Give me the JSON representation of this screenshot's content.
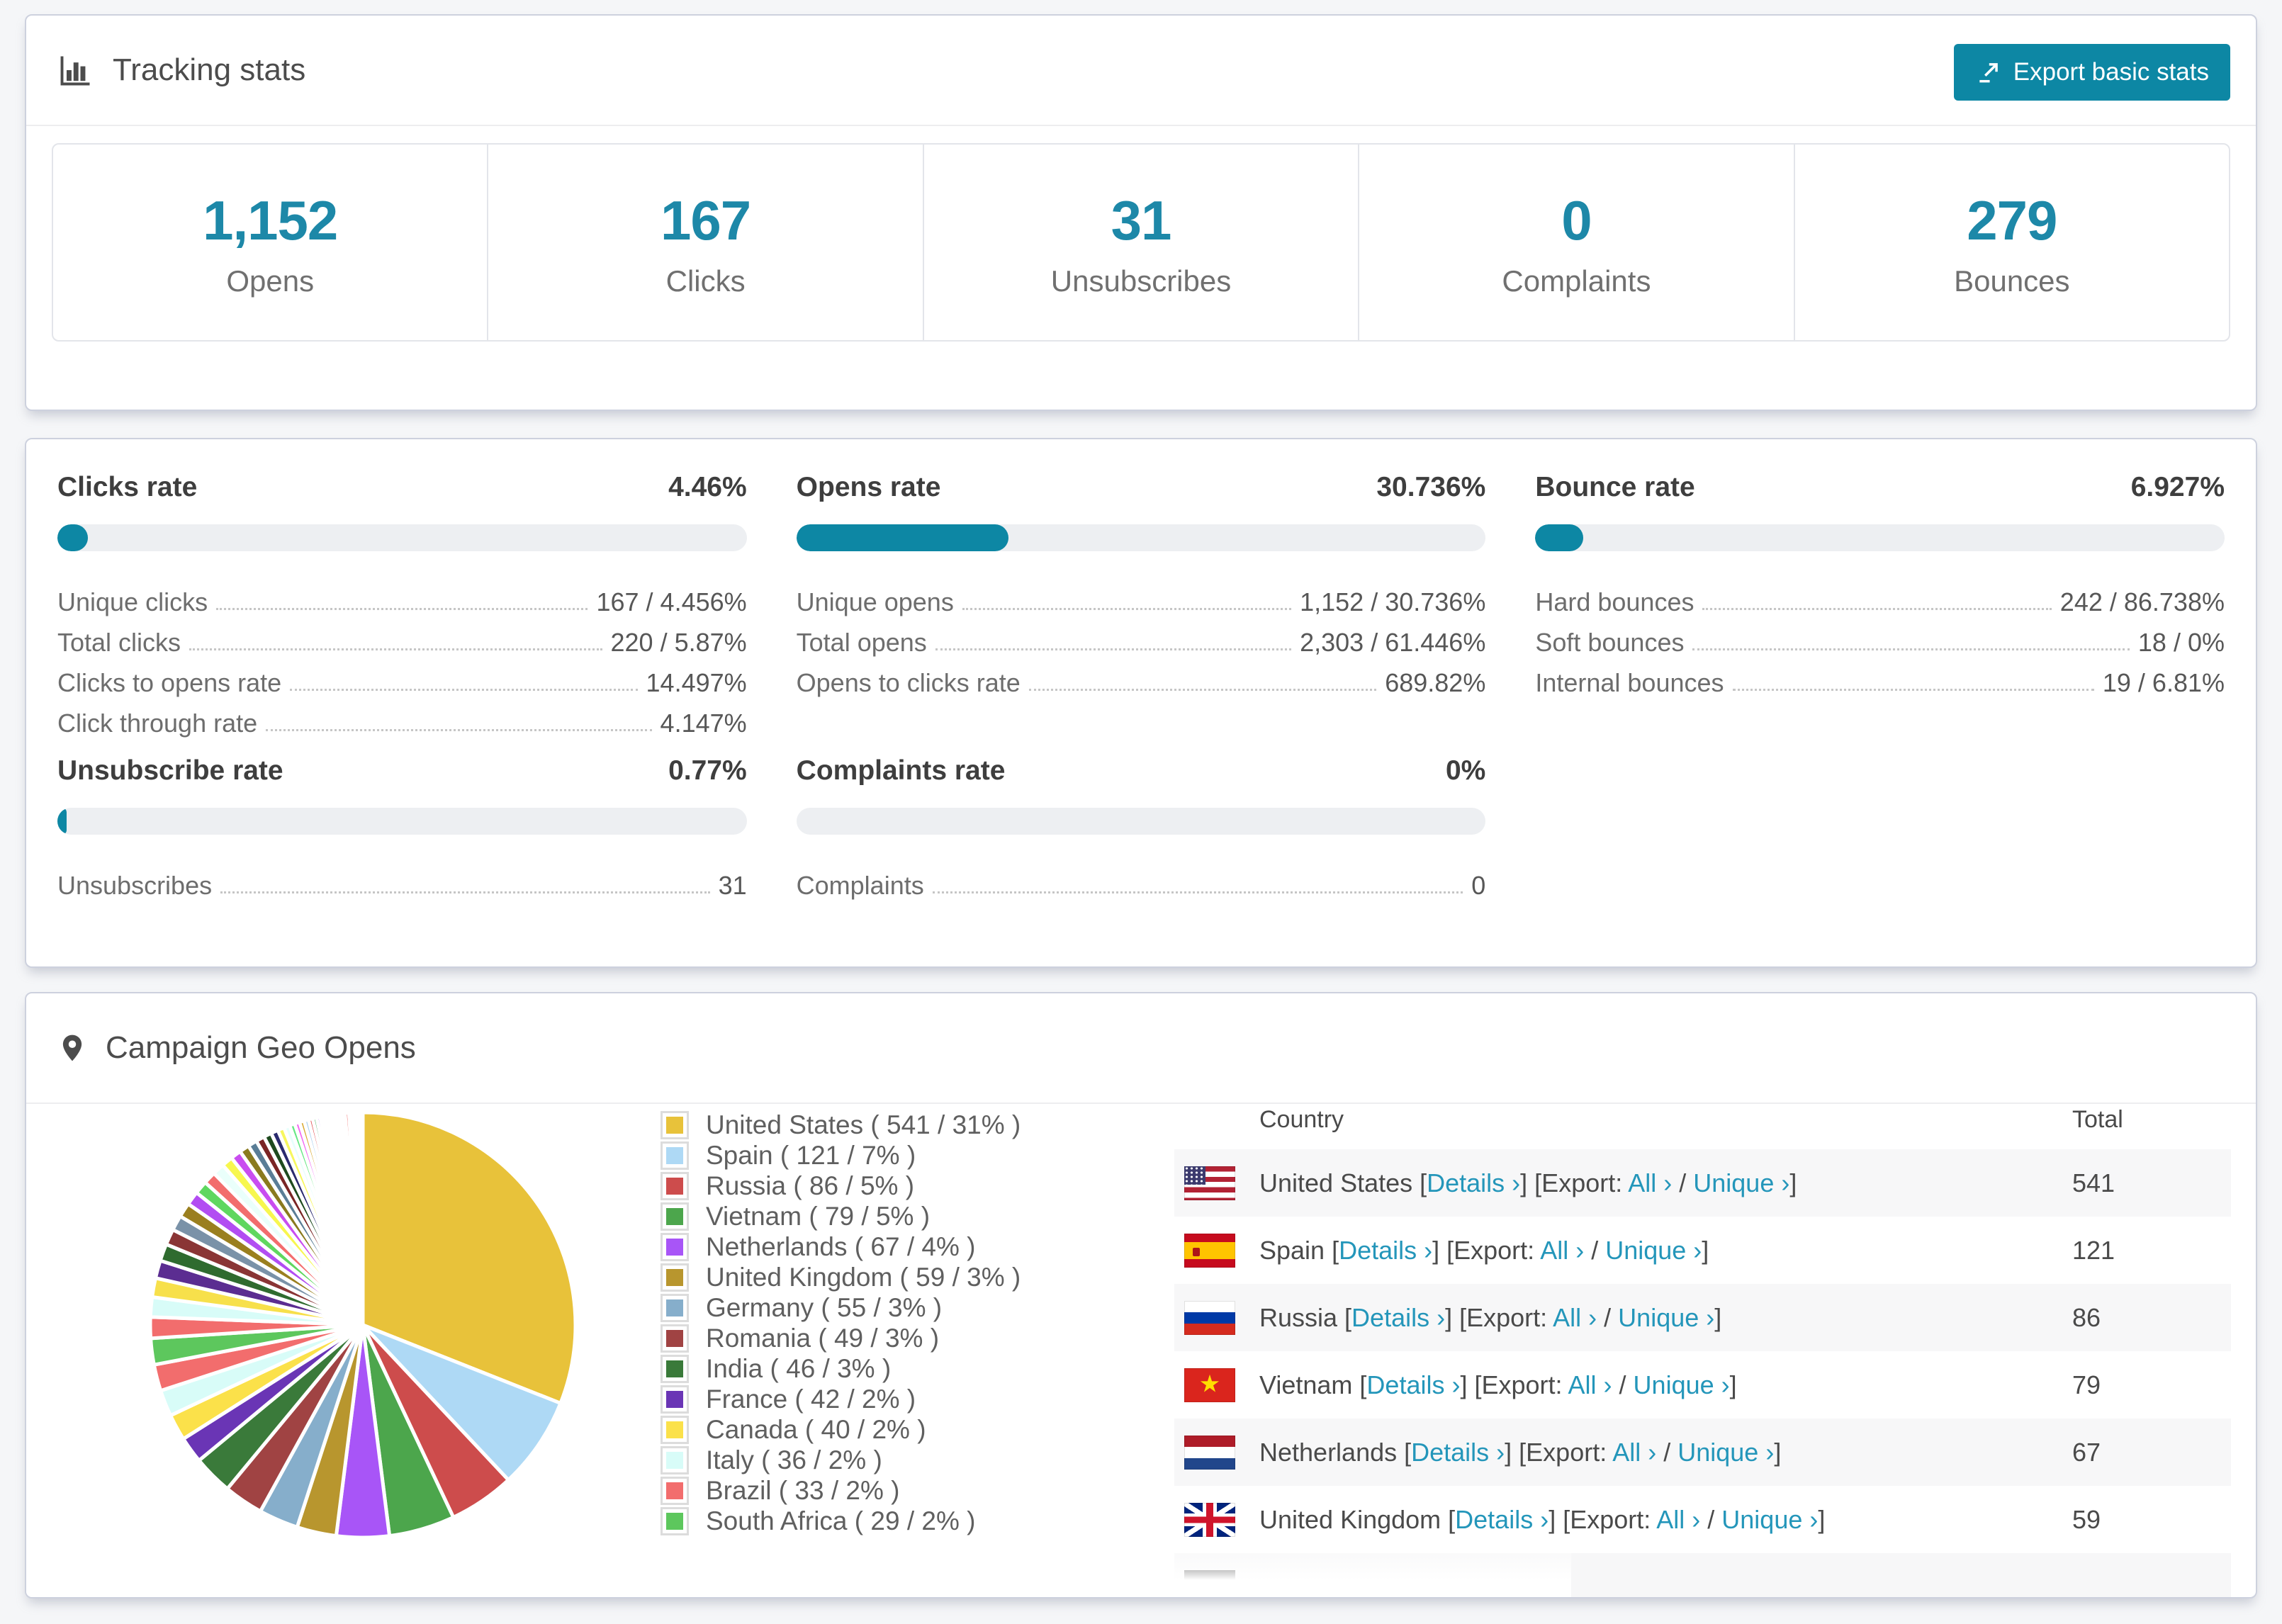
{
  "accent": "#0d87a4",
  "tracking_card": {
    "title": "Tracking stats",
    "export_button": "Export basic stats",
    "stats": [
      {
        "value": "1,152",
        "label": "Opens"
      },
      {
        "value": "167",
        "label": "Clicks"
      },
      {
        "value": "31",
        "label": "Unsubscribes"
      },
      {
        "value": "0",
        "label": "Complaints"
      },
      {
        "value": "279",
        "label": "Bounces"
      }
    ]
  },
  "rates_card": {
    "sections": [
      {
        "title": "Clicks rate",
        "value": "4.46%",
        "percent": 4.46,
        "rows": [
          {
            "label": "Unique clicks",
            "value": "167 / 4.456%"
          },
          {
            "label": "Total clicks",
            "value": "220 / 5.87%"
          },
          {
            "label": "Clicks to opens rate",
            "value": "14.497%"
          },
          {
            "label": "Click through rate",
            "value": "4.147%"
          }
        ]
      },
      {
        "title": "Opens rate",
        "value": "30.736%",
        "percent": 30.736,
        "rows": [
          {
            "label": "Unique opens",
            "value": "1,152 / 30.736%"
          },
          {
            "label": "Total opens",
            "value": "2,303 / 61.446%"
          },
          {
            "label": "Opens to clicks rate",
            "value": "689.82%"
          }
        ]
      },
      {
        "title": "Bounce rate",
        "value": "6.927%",
        "percent": 6.927,
        "rows": [
          {
            "label": "Hard bounces",
            "value": "242 / 86.738%"
          },
          {
            "label": "Soft bounces",
            "value": "18 / 0%"
          },
          {
            "label": "Internal bounces",
            "value": "19 / 6.81%"
          }
        ]
      },
      {
        "title": "Unsubscribe rate",
        "value": "0.77%",
        "percent": 0.77,
        "rows": [
          {
            "label": "Unsubscribes",
            "value": "31"
          }
        ]
      },
      {
        "title": "Complaints rate",
        "value": "0%",
        "percent": 0,
        "rows": [
          {
            "label": "Complaints",
            "value": "0"
          }
        ]
      }
    ]
  },
  "geo_card": {
    "title": "Campaign Geo Opens",
    "table": {
      "columns": [
        "Country",
        "Total"
      ],
      "details_label": "Details ›",
      "export_label": "Export:",
      "all_label": "All ›",
      "unique_label": "Unique ›",
      "rows": [
        {
          "country": "United States",
          "total": "541",
          "flag": "us"
        },
        {
          "country": "Spain",
          "total": "121",
          "flag": "es"
        },
        {
          "country": "Russia",
          "total": "86",
          "flag": "ru"
        },
        {
          "country": "Vietnam",
          "total": "79",
          "flag": "vn"
        },
        {
          "country": "Netherlands",
          "total": "67",
          "flag": "nl"
        },
        {
          "country": "United Kingdom",
          "total": "59",
          "flag": "gb"
        },
        {
          "country": "",
          "total": "",
          "flag": "de"
        }
      ]
    }
  },
  "chart_data": {
    "type": "pie",
    "title": "Campaign Geo Opens",
    "legend_position": "right",
    "start_angle_deg": -90,
    "direction": "clockwise",
    "slices": [
      {
        "label": "United States",
        "count": 541,
        "pct": 31,
        "color": "#e8c23a"
      },
      {
        "label": "Spain",
        "count": 121,
        "pct": 7,
        "color": "#aed9f5"
      },
      {
        "label": "Russia",
        "count": 86,
        "pct": 5,
        "color": "#cd4c4c"
      },
      {
        "label": "Vietnam",
        "count": 79,
        "pct": 5,
        "color": "#4ca64c"
      },
      {
        "label": "Netherlands",
        "count": 67,
        "pct": 4,
        "color": "#a855f7"
      },
      {
        "label": "United Kingdom",
        "count": 59,
        "pct": 3,
        "color": "#b8962e"
      },
      {
        "label": "Germany",
        "count": 55,
        "pct": 3,
        "color": "#86aecb"
      },
      {
        "label": "Romania",
        "count": 49,
        "pct": 3,
        "color": "#a04343"
      },
      {
        "label": "India",
        "count": 46,
        "pct": 3,
        "color": "#3a7a3a"
      },
      {
        "label": "France",
        "count": 42,
        "pct": 2,
        "color": "#6a35b5"
      },
      {
        "label": "Canada",
        "count": 40,
        "pct": 2,
        "color": "#fbe14a"
      },
      {
        "label": "Italy",
        "count": 36,
        "pct": 2,
        "color": "#d8fcf8"
      },
      {
        "label": "Brazil",
        "count": 33,
        "pct": 2,
        "color": "#f26d6d"
      },
      {
        "label": "South Africa",
        "count": 29,
        "pct": 2,
        "color": "#5dc75d"
      }
    ],
    "other_slices": [
      {
        "pct": 1.6,
        "color": "#f26d6d"
      },
      {
        "pct": 1.5,
        "color": "#d8fcf8"
      },
      {
        "pct": 1.45,
        "color": "#f7e04b"
      },
      {
        "pct": 1.35,
        "color": "#5b2d91"
      },
      {
        "pct": 1.3,
        "color": "#2f6b2f"
      },
      {
        "pct": 1.2,
        "color": "#8a3535"
      },
      {
        "pct": 1.15,
        "color": "#7a92a8"
      },
      {
        "pct": 1.1,
        "color": "#9a7f1f"
      },
      {
        "pct": 1.05,
        "color": "#b24df2"
      },
      {
        "pct": 1.0,
        "color": "#5fd75f"
      },
      {
        "pct": 0.95,
        "color": "#f26d6d"
      },
      {
        "pct": 0.9,
        "color": "#eafffb"
      },
      {
        "pct": 0.85,
        "color": "#f7f74e"
      },
      {
        "pct": 0.8,
        "color": "#c94df0"
      },
      {
        "pct": 0.75,
        "color": "#8a7a1e"
      },
      {
        "pct": 0.7,
        "color": "#5a7d96"
      },
      {
        "pct": 0.65,
        "color": "#7a2525"
      },
      {
        "pct": 0.6,
        "color": "#1e4a1e"
      },
      {
        "pct": 0.55,
        "color": "#2a2a6e"
      },
      {
        "pct": 0.5,
        "color": "#f7f75e"
      },
      {
        "pct": 0.45,
        "color": "#e8fffc"
      },
      {
        "pct": 0.4,
        "color": "#66e884"
      },
      {
        "pct": 0.38,
        "color": "#f266f2"
      },
      {
        "pct": 0.36,
        "color": "#d9aa32"
      },
      {
        "pct": 0.34,
        "color": "#a8d0f0"
      },
      {
        "pct": 0.32,
        "color": "#e05050"
      },
      {
        "pct": 0.3,
        "color": "#3fae5c"
      },
      {
        "pct": 0.28,
        "color": "#9c4df4"
      },
      {
        "pct": 0.26,
        "color": "#caa22a"
      },
      {
        "pct": 0.24,
        "color": "#88c7f7"
      },
      {
        "pct": 0.22,
        "color": "#ef5350"
      },
      {
        "pct": 0.2,
        "color": "#43a047"
      },
      {
        "pct": 0.18,
        "color": "#b266f2"
      },
      {
        "pct": 0.16,
        "color": "#caa22a"
      },
      {
        "pct": 0.14,
        "color": "#f28da0"
      },
      {
        "pct": 0.12,
        "color": "#66bb6a"
      },
      {
        "pct": 0.1,
        "color": "#ce93d8"
      },
      {
        "pct": 0.1,
        "color": "#ffd54f"
      },
      {
        "pct": 0.08,
        "color": "#90caf9"
      },
      {
        "pct": 0.08,
        "color": "#e57373"
      },
      {
        "pct": 0.3,
        "color": "#f26d6d"
      },
      {
        "pct": 0.25,
        "color": "#57d95f"
      },
      {
        "pct": 0.2,
        "color": "#e26df2"
      },
      {
        "pct": 0.15,
        "color": "#d9aa32"
      },
      {
        "pct": 0.12,
        "color": "#a8d0f0"
      },
      {
        "pct": 0.1,
        "color": "#e05050"
      },
      {
        "pct": 0.08,
        "color": "#43a047"
      },
      {
        "pct": 0.06,
        "color": "#9c4df4"
      },
      {
        "pct": 0.05,
        "color": "#caa22a"
      },
      {
        "pct": 0.03,
        "color": "#b266f2"
      }
    ]
  }
}
